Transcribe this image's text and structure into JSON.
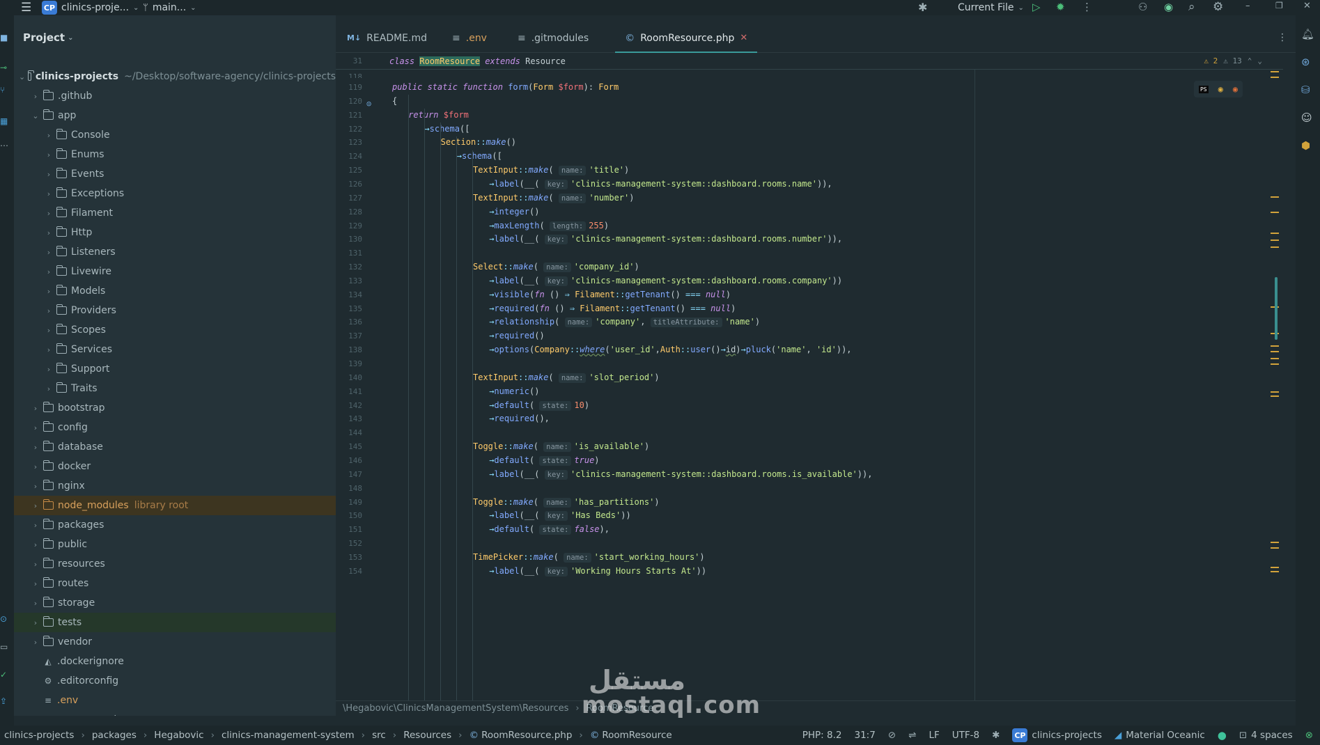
{
  "titlebar": {
    "project_badge": "CP",
    "project_name": "clinics-proje...",
    "branch": "main...",
    "run_config": "Current File"
  },
  "project_panel": {
    "title": "Project",
    "root_name": "clinics-projects",
    "root_path": "~/Desktop/software-agency/clinics-projects",
    "items": [
      {
        "label": ".github",
        "type": "folder",
        "depth": 1
      },
      {
        "label": "app",
        "type": "folder",
        "depth": 1,
        "expanded": true
      },
      {
        "label": "Console",
        "type": "folder",
        "depth": 2
      },
      {
        "label": "Enums",
        "type": "folder",
        "depth": 2
      },
      {
        "label": "Events",
        "type": "folder",
        "depth": 2
      },
      {
        "label": "Exceptions",
        "type": "folder",
        "depth": 2
      },
      {
        "label": "Filament",
        "type": "folder",
        "depth": 2
      },
      {
        "label": "Http",
        "type": "folder",
        "depth": 2
      },
      {
        "label": "Listeners",
        "type": "folder",
        "depth": 2
      },
      {
        "label": "Livewire",
        "type": "folder",
        "depth": 2
      },
      {
        "label": "Models",
        "type": "folder",
        "depth": 2
      },
      {
        "label": "Providers",
        "type": "folder",
        "depth": 2
      },
      {
        "label": "Scopes",
        "type": "folder",
        "depth": 2
      },
      {
        "label": "Services",
        "type": "folder",
        "depth": 2
      },
      {
        "label": "Support",
        "type": "folder",
        "depth": 2
      },
      {
        "label": "Traits",
        "type": "folder",
        "depth": 2
      },
      {
        "label": "bootstrap",
        "type": "folder",
        "depth": 1
      },
      {
        "label": "config",
        "type": "folder",
        "depth": 1
      },
      {
        "label": "database",
        "type": "folder",
        "depth": 1
      },
      {
        "label": "docker",
        "type": "folder",
        "depth": 1
      },
      {
        "label": "nginx",
        "type": "folder",
        "depth": 1
      },
      {
        "label": "node_modules",
        "type": "folder-orange",
        "depth": 1,
        "note": "library root"
      },
      {
        "label": "packages",
        "type": "folder",
        "depth": 1
      },
      {
        "label": "public",
        "type": "folder",
        "depth": 1
      },
      {
        "label": "resources",
        "type": "folder",
        "depth": 1
      },
      {
        "label": "routes",
        "type": "folder",
        "depth": 1
      },
      {
        "label": "storage",
        "type": "folder",
        "depth": 1
      },
      {
        "label": "tests",
        "type": "folder-green",
        "depth": 1
      },
      {
        "label": "vendor",
        "type": "folder",
        "depth": 1
      },
      {
        "label": ".dockerignore",
        "type": "file",
        "depth": 1
      },
      {
        "label": ".editorconfig",
        "type": "file",
        "depth": 1
      },
      {
        "label": ".env",
        "type": "file",
        "depth": 1
      },
      {
        "label": ".env.example",
        "type": "file",
        "depth": 1
      }
    ]
  },
  "tabs": [
    {
      "label": "README.md",
      "icon": "M↓"
    },
    {
      "label": ".env",
      "icon": "≡"
    },
    {
      "label": ".gitmodules",
      "icon": "≡"
    },
    {
      "label": "RoomResource.php",
      "icon": "©",
      "active": true
    }
  ],
  "editor": {
    "sticky_line_no": "31",
    "sticky_class_kw": "class",
    "sticky_class_name": "RoomResource",
    "sticky_extends": "extends",
    "sticky_parent": "Resource",
    "warnings": "⚠ 2",
    "weak_warnings": "⚠ 13",
    "partial_line_no": "118",
    "lines": [
      {
        "n": "119",
        "indent": 1,
        "html": "<span class='kw'>public static function</span> <span class='fn'>form</span><span class='pl'>(</span><span class='cls'>Form</span> <span class='var'>$form</span><span class='pl'>): </span><span class='cls'>Form</span>"
      },
      {
        "n": "120",
        "indent": 1,
        "html": "<span class='pl'>{</span>"
      },
      {
        "n": "121",
        "indent": 2,
        "html": "<span class='kw'>return</span> <span class='var'>$form</span>"
      },
      {
        "n": "122",
        "indent": 3,
        "html": "<span class='op'>→</span><span class='fn'>schema</span><span class='pl'>([</span>"
      },
      {
        "n": "123",
        "indent": 4,
        "html": "<span class='cls'>Section</span><span class='op'>::</span><span class='fn' style='font-style:italic'>make</span><span class='pl'>()</span>"
      },
      {
        "n": "124",
        "indent": 5,
        "html": "<span class='op'>→</span><span class='fn'>schema</span><span class='pl'>([</span>"
      },
      {
        "n": "125",
        "indent": 6,
        "html": "<span class='cls'>TextInput</span><span class='op'>::</span><span class='fn' style='font-style:italic'>make</span><span class='pl'>( </span><span class='hint'>name:</span><span class='str'>'title'</span><span class='pl'>)</span>"
      },
      {
        "n": "126",
        "indent": 7,
        "html": "<span class='op'>→</span><span class='fn'>label</span><span class='pl'>(__( </span><span class='hint'>key:</span><span class='str'>'clinics-management-system::dashboard.rooms.name'</span><span class='pl'>)),</span>"
      },
      {
        "n": "127",
        "indent": 6,
        "html": "<span class='cls'>TextInput</span><span class='op'>::</span><span class='fn' style='font-style:italic'>make</span><span class='pl'>( </span><span class='hint'>name:</span><span class='str'>'number'</span><span class='pl'>)</span>"
      },
      {
        "n": "128",
        "indent": 7,
        "html": "<span class='op'>→</span><span class='fn'>integer</span><span class='pl'>()</span>"
      },
      {
        "n": "129",
        "indent": 7,
        "html": "<span class='op'>→</span><span class='fn'>maxLength</span><span class='pl'>( </span><span class='hint'>length:</span><span class='num'>255</span><span class='pl'>)</span>"
      },
      {
        "n": "130",
        "indent": 7,
        "html": "<span class='op'>→</span><span class='fn'>label</span><span class='pl'>(__( </span><span class='hint'>key:</span><span class='str'>'clinics-management-system::dashboard.rooms.number'</span><span class='pl'>)),</span>"
      },
      {
        "n": "131",
        "indent": 0,
        "html": ""
      },
      {
        "n": "132",
        "indent": 6,
        "html": "<span class='cls'>Select</span><span class='op'>::</span><span class='fn' style='font-style:italic'>make</span><span class='pl'>( </span><span class='hint'>name:</span><span class='str'>'company_id'</span><span class='pl'>)</span>"
      },
      {
        "n": "133",
        "indent": 7,
        "html": "<span class='op'>→</span><span class='fn'>label</span><span class='pl'>(__( </span><span class='hint'>key:</span><span class='str'>'clinics-management-system::dashboard.rooms.company'</span><span class='pl'>))</span>"
      },
      {
        "n": "134",
        "indent": 7,
        "html": "<span class='op'>→</span><span class='fn'>visible</span><span class='pl'>(</span><span class='kw'>fn</span><span class='pl'> () </span><span class='op'>⇒</span> <span class='cls'>Filament</span><span class='op'>::</span><span class='fn'>getTenant</span><span class='pl'>() </span><span class='op'>===</span> <span class='kw'>null</span><span class='pl'>)</span>"
      },
      {
        "n": "135",
        "indent": 7,
        "html": "<span class='op'>→</span><span class='fn'>required</span><span class='pl'>(</span><span class='kw'>fn</span><span class='pl'> () </span><span class='op'>⇒</span> <span class='cls'>Filament</span><span class='op'>::</span><span class='fn'>getTenant</span><span class='pl'>() </span><span class='op'>===</span> <span class='kw'>null</span><span class='pl'>)</span>"
      },
      {
        "n": "136",
        "indent": 7,
        "html": "<span class='op'>→</span><span class='fn'>relationship</span><span class='pl'>( </span><span class='hint'>name:</span><span class='str'>'company'</span><span class='pl'>, </span><span class='hint'>titleAttribute:</span><span class='str'>'name'</span><span class='pl'>)</span>"
      },
      {
        "n": "137",
        "indent": 7,
        "html": "<span class='op'>→</span><span class='fn'>required</span><span class='pl'>()</span>"
      },
      {
        "n": "138",
        "indent": 7,
        "html": "<span class='op'>→</span><span class='fn'>options</span><span class='pl'>(</span><span class='cls'>Company</span><span class='op'>::</span><span class='fn' style='font-style:italic;text-decoration:underline wavy #6c8c5c'>where</span><span class='pl'>(</span><span class='str'>'user_id'</span><span class='pl'>,</span><span class='cls'>Auth</span><span class='op'>::</span><span class='fn'>user</span><span class='pl'>()</span><span class='op'>→</span><span class='pl' style='text-decoration:underline wavy #6c8c5c'>id</span><span class='pl'>)</span><span class='op'>→</span><span class='fn'>pluck</span><span class='pl'>(</span><span class='str'>'name'</span><span class='pl'>, </span><span class='str'>'id'</span><span class='pl'>)),</span>"
      },
      {
        "n": "139",
        "indent": 0,
        "html": ""
      },
      {
        "n": "140",
        "indent": 6,
        "html": "<span class='cls'>TextInput</span><span class='op'>::</span><span class='fn' style='font-style:italic'>make</span><span class='pl'>( </span><span class='hint'>name:</span><span class='str'>'slot_period'</span><span class='pl'>)</span>"
      },
      {
        "n": "141",
        "indent": 7,
        "html": "<span class='op'>→</span><span class='fn'>numeric</span><span class='pl'>()</span>"
      },
      {
        "n": "142",
        "indent": 7,
        "html": "<span class='op'>→</span><span class='fn'>default</span><span class='pl'>( </span><span class='hint'>state:</span><span class='num'>10</span><span class='pl'>)</span>"
      },
      {
        "n": "143",
        "indent": 7,
        "html": "<span class='op'>→</span><span class='fn'>required</span><span class='pl'>(),</span>"
      },
      {
        "n": "144",
        "indent": 0,
        "html": ""
      },
      {
        "n": "145",
        "indent": 6,
        "html": "<span class='cls'>Toggle</span><span class='op'>::</span><span class='fn' style='font-style:italic'>make</span><span class='pl'>( </span><span class='hint'>name:</span><span class='str'>'is_available'</span><span class='pl'>)</span>"
      },
      {
        "n": "146",
        "indent": 7,
        "html": "<span class='op'>→</span><span class='fn'>default</span><span class='pl'>( </span><span class='hint'>state:</span><span class='kw'>true</span><span class='pl'>)</span>"
      },
      {
        "n": "147",
        "indent": 7,
        "html": "<span class='op'>→</span><span class='fn'>label</span><span class='pl'>(__( </span><span class='hint'>key:</span><span class='str'>'clinics-management-system::dashboard.rooms.is_available'</span><span class='pl'>)),</span>"
      },
      {
        "n": "148",
        "indent": 0,
        "html": ""
      },
      {
        "n": "149",
        "indent": 6,
        "html": "<span class='cls'>Toggle</span><span class='op'>::</span><span class='fn' style='font-style:italic'>make</span><span class='pl'>( </span><span class='hint'>name:</span><span class='str'>'has_partitions'</span><span class='pl'>)</span>"
      },
      {
        "n": "150",
        "indent": 7,
        "html": "<span class='op'>→</span><span class='fn'>label</span><span class='pl'>(__( </span><span class='hint'>key:</span><span class='str'>'Has Beds'</span><span class='pl'>))</span>"
      },
      {
        "n": "151",
        "indent": 7,
        "html": "<span class='op'>→</span><span class='fn'>default</span><span class='pl'>( </span><span class='hint'>state:</span><span class='kw'>false</span><span class='pl'>),</span>"
      },
      {
        "n": "152",
        "indent": 0,
        "html": ""
      },
      {
        "n": "153",
        "indent": 6,
        "html": "<span class='cls'>TimePicker</span><span class='op'>::</span><span class='fn' style='font-style:italic'>make</span><span class='pl'>( </span><span class='hint'>name:</span><span class='str'>'start_working_hours'</span><span class='pl'>)</span>"
      },
      {
        "n": "154",
        "indent": 7,
        "html": "<span class='op'>→</span><span class='fn'>label</span><span class='pl'>(__( </span><span class='hint'>key:</span><span class='str'>'Working Hours Starts At'</span><span class='pl'>))</span>"
      }
    ]
  },
  "editor_breadcrumb": {
    "namespace": "\\Hegabovic\\ClinicsManagementSystem\\Resources",
    "class_name": "RoomResource"
  },
  "statusbar": {
    "crumbs": [
      "clinics-projects",
      "packages",
      "Hegabovic",
      "clinics-management-system",
      "src",
      "Resources",
      "RoomResource.php",
      "RoomResource"
    ],
    "php_version": "PHP: 8.2",
    "cursor": "31:7",
    "line_sep": "LF",
    "encoding": "UTF-8",
    "project_badge": "CP",
    "project": "clinics-projects",
    "theme": "Material Oceanic",
    "indent": "4 spaces"
  },
  "watermark": {
    "arabic": "مستقل",
    "latin": "mostaql.com"
  }
}
